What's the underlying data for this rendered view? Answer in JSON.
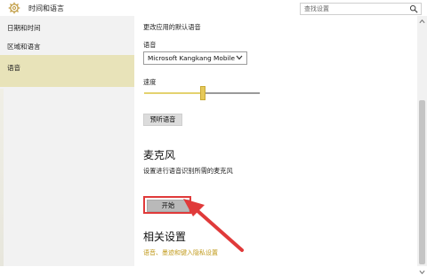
{
  "window": {
    "title": "时间和语言",
    "search_placeholder": "查找设置"
  },
  "sidebar": {
    "items": [
      {
        "label": "日期和时间",
        "active": false
      },
      {
        "label": "区域和语言",
        "active": false
      },
      {
        "label": "语音",
        "active": true
      }
    ]
  },
  "main": {
    "default_voice_caption": "更改应用的默认语音",
    "voice_label": "语音",
    "voice_selected": "Microsoft Kangkang Mobile",
    "speed_label": "速度",
    "speed_value_percent": 50,
    "preview_button": "预听语音",
    "mic_heading": "麦克风",
    "mic_description": "设置进行语音识别所需的麦克风",
    "start_button": "开始",
    "related_heading": "相关设置",
    "related_link": "语音、墨迹和键入隐私设置"
  },
  "colors": {
    "accent": "#e6c95a",
    "link": "#c19a1b",
    "highlight_box": "#e03a3a",
    "active_sidebar": "#e8e3b9"
  },
  "icons": {
    "app": "gear-icon",
    "search": "search-icon",
    "dropdown": "chevron-down-icon"
  }
}
